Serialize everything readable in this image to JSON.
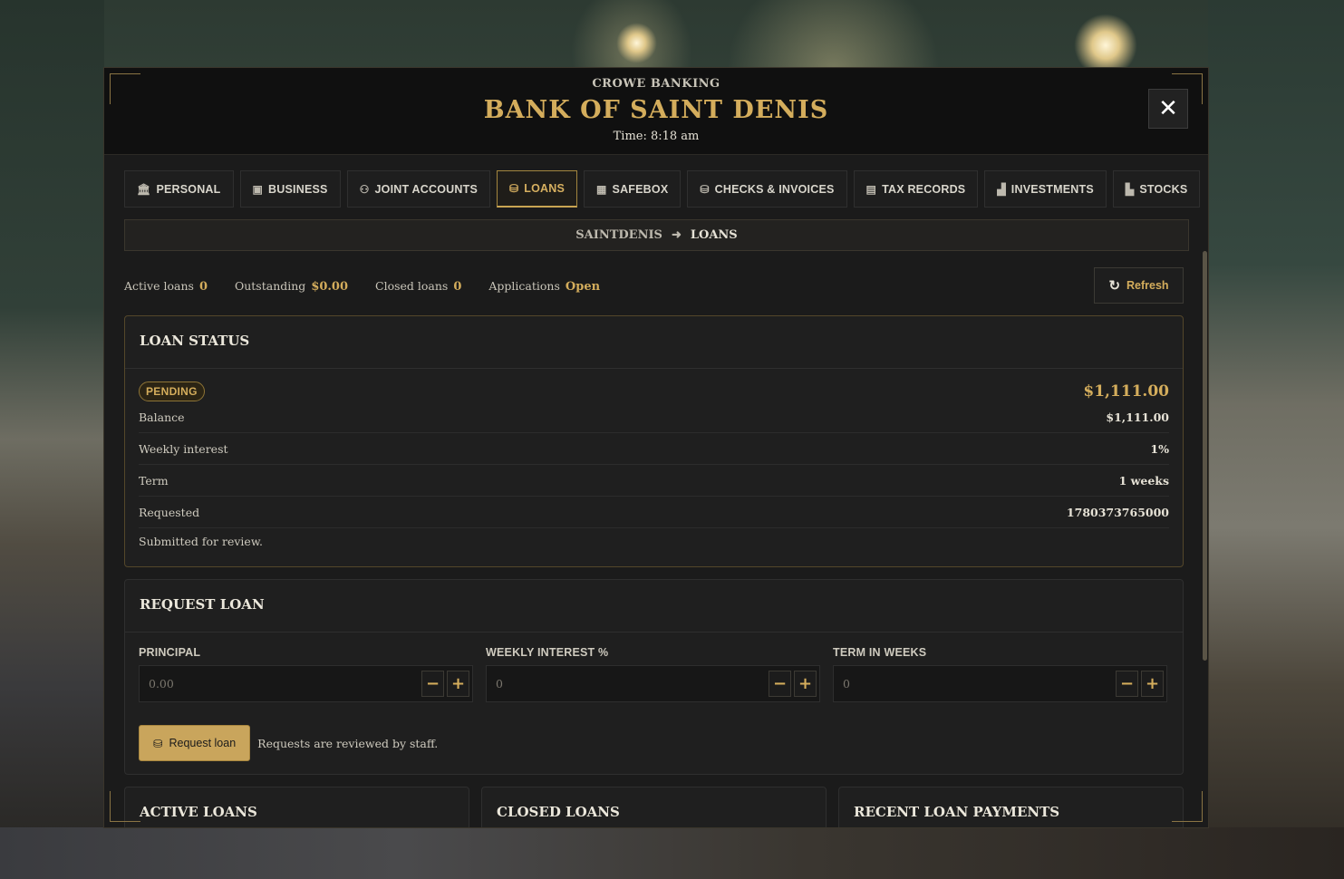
{
  "header": {
    "subtitle": "CROWE BANKING",
    "title": "BANK OF SAINT DENIS",
    "time": "Time: 8:18 am"
  },
  "tabs": [
    {
      "label": "PERSONAL",
      "icon": "bank-icon"
    },
    {
      "label": "BUSINESS",
      "icon": "briefcase-icon"
    },
    {
      "label": "JOINT ACCOUNTS",
      "icon": "users-icon"
    },
    {
      "label": "LOANS",
      "icon": "cash-icon",
      "active": true
    },
    {
      "label": "SAFEBOX",
      "icon": "safe-icon"
    },
    {
      "label": "CHECKS & INVOICES",
      "icon": "check-icon"
    },
    {
      "label": "TAX RECORDS",
      "icon": "receipt-icon"
    },
    {
      "label": "INVESTMENTS",
      "icon": "chart-icon"
    },
    {
      "label": "STOCKS",
      "icon": "bar-chart-icon"
    }
  ],
  "breadcrumb": {
    "parent": "SAINTDENIS",
    "separator": "➜",
    "current": "LOANS"
  },
  "stats": [
    {
      "label": "Active loans",
      "value": "0"
    },
    {
      "label": "Outstanding",
      "value": "$0.00"
    },
    {
      "label": "Closed loans",
      "value": "0"
    },
    {
      "label": "Applications",
      "value": "Open"
    }
  ],
  "refresh_label": "Refresh",
  "loan_status": {
    "title": "LOAN STATUS",
    "badge": "PENDING",
    "amount": "$1,111.00",
    "rows": [
      {
        "key": "Balance",
        "value": "$1,111.00"
      },
      {
        "key": "Weekly interest",
        "value": "1%"
      },
      {
        "key": "Term",
        "value": "1 weeks"
      },
      {
        "key": "Requested",
        "value": "1780373765000"
      }
    ],
    "note": "Submitted for review."
  },
  "request_loan": {
    "title": "REQUEST LOAN",
    "fields": [
      {
        "label": "PRINCIPAL",
        "placeholder": "0.00"
      },
      {
        "label": "WEEKLY INTEREST %",
        "placeholder": "0"
      },
      {
        "label": "TERM IN WEEKS",
        "placeholder": "0"
      }
    ],
    "button_label": "Request loan",
    "note": "Requests are reviewed by staff."
  },
  "bottom_panels": [
    "ACTIVE LOANS",
    "CLOSED LOANS",
    "RECENT LOAN PAYMENTS"
  ],
  "colors": {
    "accent": "#d4ad5c",
    "background": "#1b1b1b",
    "button": "#c9a55c"
  }
}
